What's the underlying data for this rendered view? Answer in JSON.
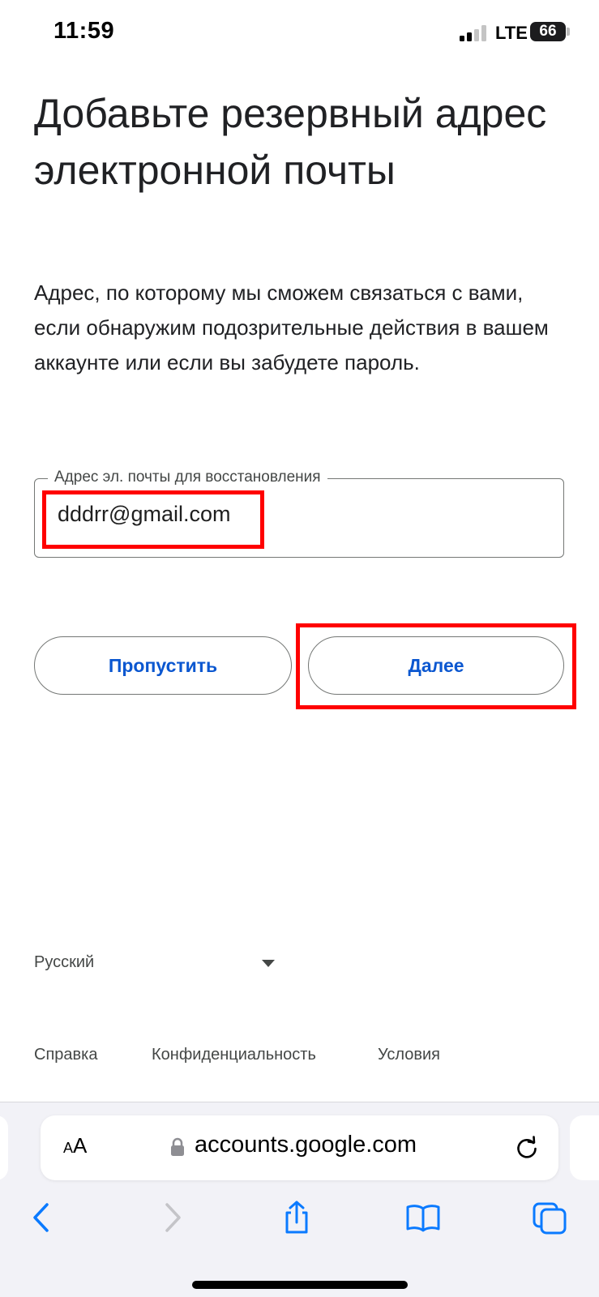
{
  "status_bar": {
    "time": "11:59",
    "network": "LTE",
    "battery": "66"
  },
  "page": {
    "title": "Добавьте резервный адрес электронной почты",
    "description": "Адрес, по которому мы сможем связаться с вами, если обнаружим подозрительные действия в вашем аккаунте или если вы забудете пароль."
  },
  "email_field": {
    "label": "Адрес эл. почты для восстановления",
    "value": "dddrr@gmail.com"
  },
  "buttons": {
    "skip": "Пропустить",
    "next": "Далее"
  },
  "language": {
    "selected": "Русский"
  },
  "footer": {
    "help": "Справка",
    "privacy": "Конфиденциальность",
    "terms": "Условия"
  },
  "browser": {
    "aa_label_small": "A",
    "aa_label_large": "A",
    "url": "accounts.google.com"
  },
  "colors": {
    "accent": "#0b57d0",
    "highlight": "#ff0000",
    "text": "#202124"
  }
}
